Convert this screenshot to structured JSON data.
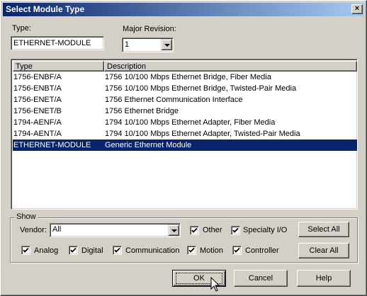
{
  "window": {
    "title": "Select Module Type",
    "close_glyph": "×"
  },
  "type_field": {
    "label": "Type:",
    "value": "ETHERNET-MODULE"
  },
  "major_revision": {
    "label": "Major Revision:",
    "value": "1"
  },
  "list": {
    "columns": [
      "Type",
      "Description"
    ],
    "rows": [
      {
        "type": "1756-ENBF/A",
        "description": "1756 10/100 Mbps Ethernet Bridge, Fiber Media"
      },
      {
        "type": "1756-ENBT/A",
        "description": "1756 10/100 Mbps Ethernet Bridge, Twisted-Pair Media"
      },
      {
        "type": "1756-ENET/A",
        "description": "1756 Ethernet Communication Interface"
      },
      {
        "type": "1756-ENET/B",
        "description": "1756 Ethernet Bridge"
      },
      {
        "type": "1794-AENF/A",
        "description": "1794 10/100 Mbps Ethernet Adapter, Fiber Media"
      },
      {
        "type": "1794-AENT/A",
        "description": "1794 10/100 Mbps Ethernet Adapter, Twisted-Pair Media"
      },
      {
        "type": "ETHERNET-MODULE",
        "description": "Generic Ethernet Module",
        "selected": true
      }
    ]
  },
  "show": {
    "title": "Show",
    "vendor_label": "Vendor:",
    "vendor_value": "All",
    "other": {
      "label": "Other",
      "checked": true
    },
    "specialty_io": {
      "label": "Specialty I/O",
      "checked": true
    },
    "analog": {
      "label": "Analog",
      "checked": true
    },
    "digital": {
      "label": "Digital",
      "checked": true
    },
    "communication": {
      "label": "Communication",
      "checked": true
    },
    "motion": {
      "label": "Motion",
      "checked": true
    },
    "controller": {
      "label": "Controller",
      "checked": true
    },
    "select_all_label": "Select All",
    "clear_all_label": "Clear All"
  },
  "buttons": {
    "ok": "OK",
    "cancel": "Cancel",
    "help": "Help"
  },
  "colors": {
    "title_bar": "#0a246a",
    "selection": "#0a246a",
    "face": "#d4d0c8"
  }
}
